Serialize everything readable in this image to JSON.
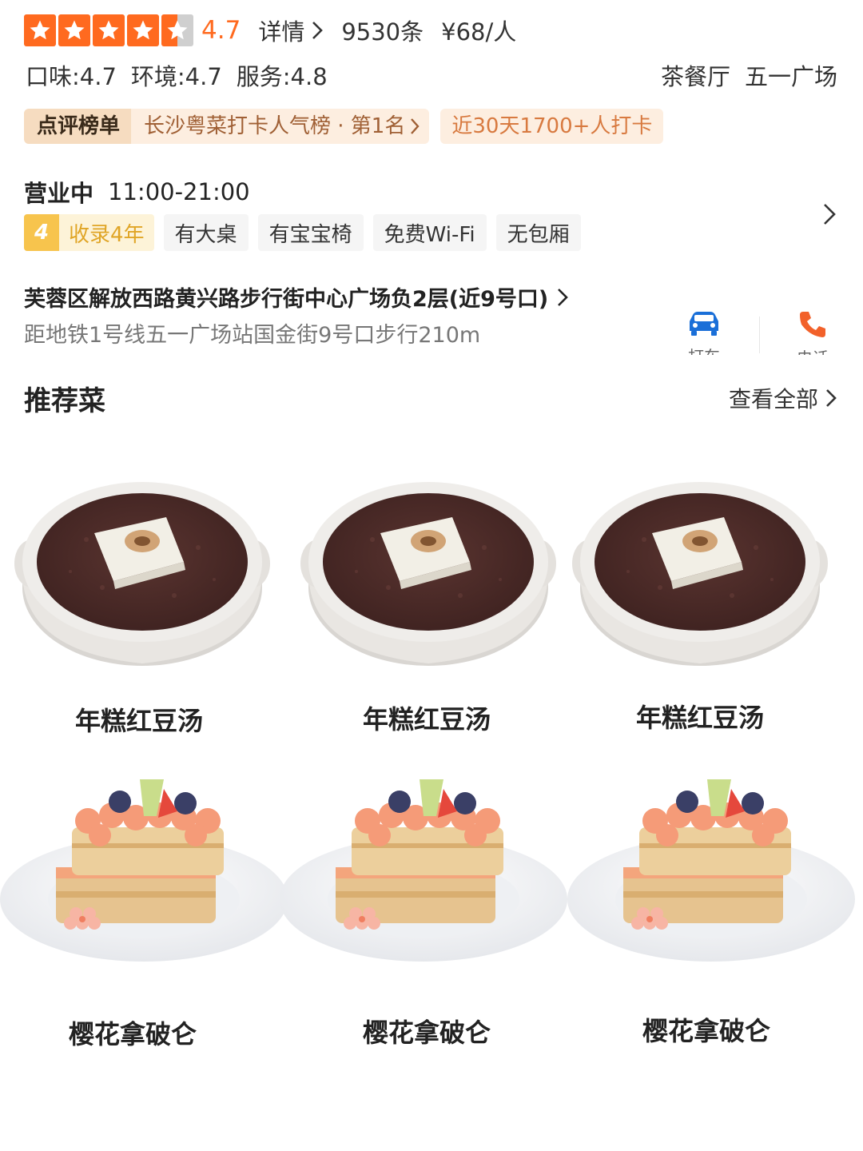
{
  "rating": {
    "score": "4.7",
    "stars_value": 4.7,
    "details_label": "详情",
    "review_count": "9530条",
    "price": "¥68/人",
    "star_color": "#ff6a1f"
  },
  "subscores": {
    "taste": "口味:4.7",
    "environment": "环境:4.7",
    "service": "服务:4.8"
  },
  "category": {
    "type": "茶餐厅",
    "area": "五一广场"
  },
  "ranking": {
    "label": "点评榜单",
    "text": "长沙粤菜打卡人气榜 · 第1名",
    "checkin": "近30天1700+人打卡"
  },
  "hours": {
    "status": "营业中",
    "time": "11:00-21:00"
  },
  "tags": {
    "years_num": "4",
    "years_text": "收录4年",
    "items": [
      "有大桌",
      "有宝宝椅",
      "免费Wi-Fi",
      "无包厢"
    ]
  },
  "location": {
    "address": "芙蓉区解放西路黄兴路步行街中心广场负2层(近9号口)",
    "distance": "距地铁1号线五一广场站国金街9号口步行210m"
  },
  "actions": {
    "taxi": "打车",
    "phone": "电话"
  },
  "recommended": {
    "title": "推荐菜",
    "see_all": "查看全部",
    "dishes": [
      {
        "name": "年糕红豆汤",
        "icon": "red-bean-soup-image"
      },
      {
        "name": "年糕红豆汤",
        "icon": "red-bean-soup-image"
      },
      {
        "name": "年糕红豆汤",
        "icon": "red-bean-soup-image"
      },
      {
        "name": "樱花拿破仑",
        "icon": "napoleon-cake-image"
      },
      {
        "name": "樱花拿破仑",
        "icon": "napoleon-cake-image"
      },
      {
        "name": "樱花拿破仑",
        "icon": "napoleon-cake-image"
      }
    ]
  }
}
